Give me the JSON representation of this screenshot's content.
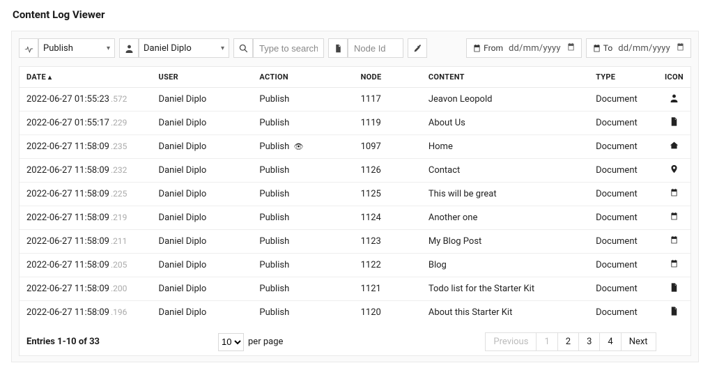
{
  "title": "Content Log Viewer",
  "toolbar": {
    "action_select": "Publish",
    "user_select": "Daniel Diplo",
    "search_placeholder": "Type to search...",
    "node_placeholder": "Node Id",
    "from_label": "From",
    "to_label": "To",
    "date_placeholder": "dd/mm/yyyy"
  },
  "columns": {
    "date": "DATE",
    "user": "USER",
    "action": "ACTION",
    "node": "NODE",
    "content": "CONTENT",
    "type": "TYPE",
    "icon": "ICON"
  },
  "rows": [
    {
      "date": "2022-06-27 01:55:23",
      "ms": ".572",
      "user": "Daniel Diplo",
      "action": "Publish",
      "eye": false,
      "node": "1117",
      "content": "Jeavon Leopold",
      "type": "Document",
      "icon": "user"
    },
    {
      "date": "2022-06-27 01:55:17",
      "ms": ".229",
      "user": "Daniel Diplo",
      "action": "Publish",
      "eye": false,
      "node": "1119",
      "content": "About Us",
      "type": "Document",
      "icon": "doc"
    },
    {
      "date": "2022-06-27 11:58:09",
      "ms": ".235",
      "user": "Daniel Diplo",
      "action": "Publish",
      "eye": true,
      "node": "1097",
      "content": "Home",
      "type": "Document",
      "icon": "home"
    },
    {
      "date": "2022-06-27 11:58:09",
      "ms": ".232",
      "user": "Daniel Diplo",
      "action": "Publish",
      "eye": false,
      "node": "1126",
      "content": "Contact",
      "type": "Document",
      "icon": "pin"
    },
    {
      "date": "2022-06-27 11:58:09",
      "ms": ".225",
      "user": "Daniel Diplo",
      "action": "Publish",
      "eye": false,
      "node": "1125",
      "content": "This will be great",
      "type": "Document",
      "icon": "cal"
    },
    {
      "date": "2022-06-27 11:58:09",
      "ms": ".219",
      "user": "Daniel Diplo",
      "action": "Publish",
      "eye": false,
      "node": "1124",
      "content": "Another one",
      "type": "Document",
      "icon": "cal"
    },
    {
      "date": "2022-06-27 11:58:09",
      "ms": ".211",
      "user": "Daniel Diplo",
      "action": "Publish",
      "eye": false,
      "node": "1123",
      "content": "My Blog Post",
      "type": "Document",
      "icon": "cal"
    },
    {
      "date": "2022-06-27 11:58:09",
      "ms": ".205",
      "user": "Daniel Diplo",
      "action": "Publish",
      "eye": false,
      "node": "1122",
      "content": "Blog",
      "type": "Document",
      "icon": "cal"
    },
    {
      "date": "2022-06-27 11:58:09",
      "ms": ".200",
      "user": "Daniel Diplo",
      "action": "Publish",
      "eye": false,
      "node": "1121",
      "content": "Todo list for the Starter Kit",
      "type": "Document",
      "icon": "doc"
    },
    {
      "date": "2022-06-27 11:58:09",
      "ms": ".196",
      "user": "Daniel Diplo",
      "action": "Publish",
      "eye": false,
      "node": "1120",
      "content": "About this Starter Kit",
      "type": "Document",
      "icon": "doc"
    }
  ],
  "footer": {
    "entries": "Entries 1-10 of 33",
    "per_page_value": "10",
    "per_page_label": "per page",
    "prev": "Previous",
    "next": "Next",
    "pages": [
      "1",
      "2",
      "3",
      "4"
    ]
  }
}
